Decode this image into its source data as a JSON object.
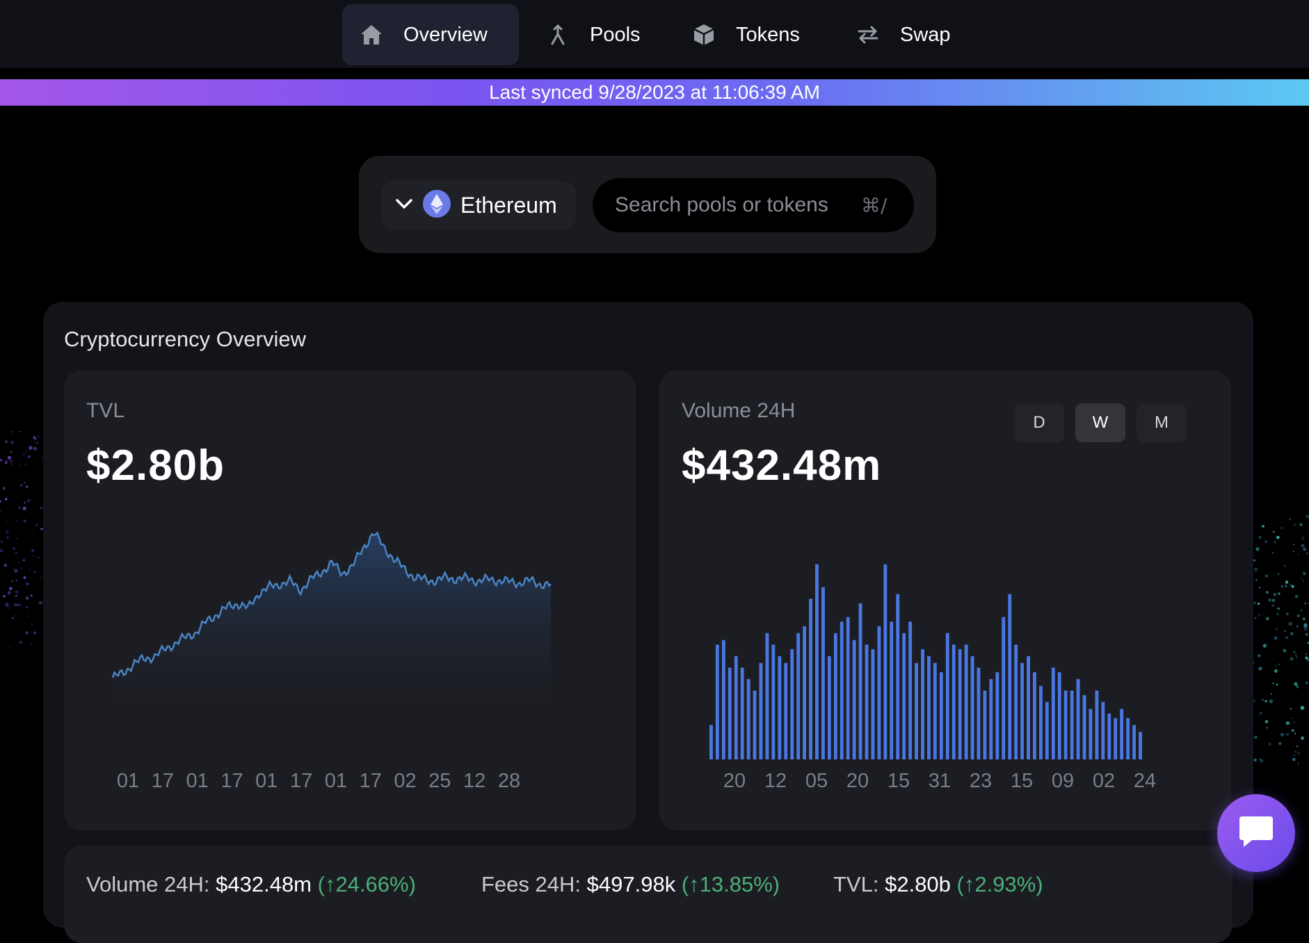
{
  "nav": {
    "items": [
      {
        "label": "Overview",
        "icon": "home-icon",
        "active": true
      },
      {
        "label": "Pools",
        "icon": "merge-icon",
        "active": false
      },
      {
        "label": "Tokens",
        "icon": "cube-icon",
        "active": false
      },
      {
        "label": "Swap",
        "icon": "swap-arrows-icon",
        "active": false
      }
    ]
  },
  "sync": {
    "text": "Last synced 9/28/2023 at 11:06:39 AM"
  },
  "search": {
    "chain": "Ethereum",
    "chain_icon": "ethereum-icon",
    "placeholder": "Search pools or tokens",
    "shortcut": "⌘/"
  },
  "overview": {
    "title": "Cryptocurrency Overview",
    "tvl": {
      "label": "TVL",
      "value": "$2.80b"
    },
    "volume": {
      "label": "Volume 24H",
      "value": "$432.48m",
      "timeframes": [
        "D",
        "W",
        "M"
      ],
      "active_timeframe": "W"
    }
  },
  "stats": {
    "volume": {
      "label": "Volume 24H:",
      "value": "$432.48m",
      "change": "(↑24.66%)"
    },
    "fees": {
      "label": "Fees 24H:",
      "value": "$497.98k",
      "change": "(↑13.85%)"
    },
    "tvl": {
      "label": "TVL:",
      "value": "$2.80b",
      "change": "(↑2.93%)"
    }
  },
  "colors": {
    "accent": "#4a84c4",
    "positive": "#4caf7a",
    "bar": "#4a76e0"
  },
  "chart_data": [
    {
      "type": "area",
      "x_tick_labels": [
        "01",
        "17",
        "01",
        "17",
        "01",
        "17",
        "01",
        "17",
        "02",
        "25",
        "12",
        "28"
      ],
      "values": [
        0.55,
        0.62,
        0.78,
        0.86,
        0.9,
        1.02,
        1.12,
        1.22,
        1.3,
        1.48,
        1.6,
        1.72,
        1.78,
        1.7,
        1.95,
        2.05,
        2.1,
        2.15,
        2.0,
        2.18,
        2.3,
        2.45,
        2.28,
        2.4,
        2.7,
        2.95,
        2.72,
        2.5,
        2.35,
        2.2,
        2.18,
        2.15,
        2.22,
        2.18,
        2.2,
        2.15,
        2.18,
        2.16,
        2.14,
        2.12,
        2.16,
        2.1,
        2.08
      ],
      "unit": "normalized"
    },
    {
      "type": "bar",
      "x_tick_labels": [
        "20",
        "12",
        "05",
        "20",
        "15",
        "31",
        "23",
        "15",
        "09",
        "02",
        "24"
      ],
      "values": [
        0.15,
        0.5,
        0.52,
        0.4,
        0.45,
        0.4,
        0.35,
        0.3,
        0.42,
        0.55,
        0.5,
        0.45,
        0.42,
        0.48,
        0.55,
        0.58,
        0.7,
        0.85,
        0.75,
        0.45,
        0.55,
        0.6,
        0.62,
        0.52,
        0.68,
        0.5,
        0.48,
        0.58,
        0.85,
        0.6,
        0.72,
        0.55,
        0.6,
        0.42,
        0.48,
        0.45,
        0.42,
        0.38,
        0.55,
        0.5,
        0.48,
        0.5,
        0.45,
        0.4,
        0.3,
        0.35,
        0.38,
        0.62,
        0.72,
        0.5,
        0.42,
        0.45,
        0.38,
        0.32,
        0.25,
        0.4,
        0.38,
        0.3,
        0.3,
        0.35,
        0.28,
        0.22,
        0.3,
        0.25,
        0.2,
        0.18,
        0.22,
        0.18,
        0.15,
        0.12
      ]
    }
  ]
}
